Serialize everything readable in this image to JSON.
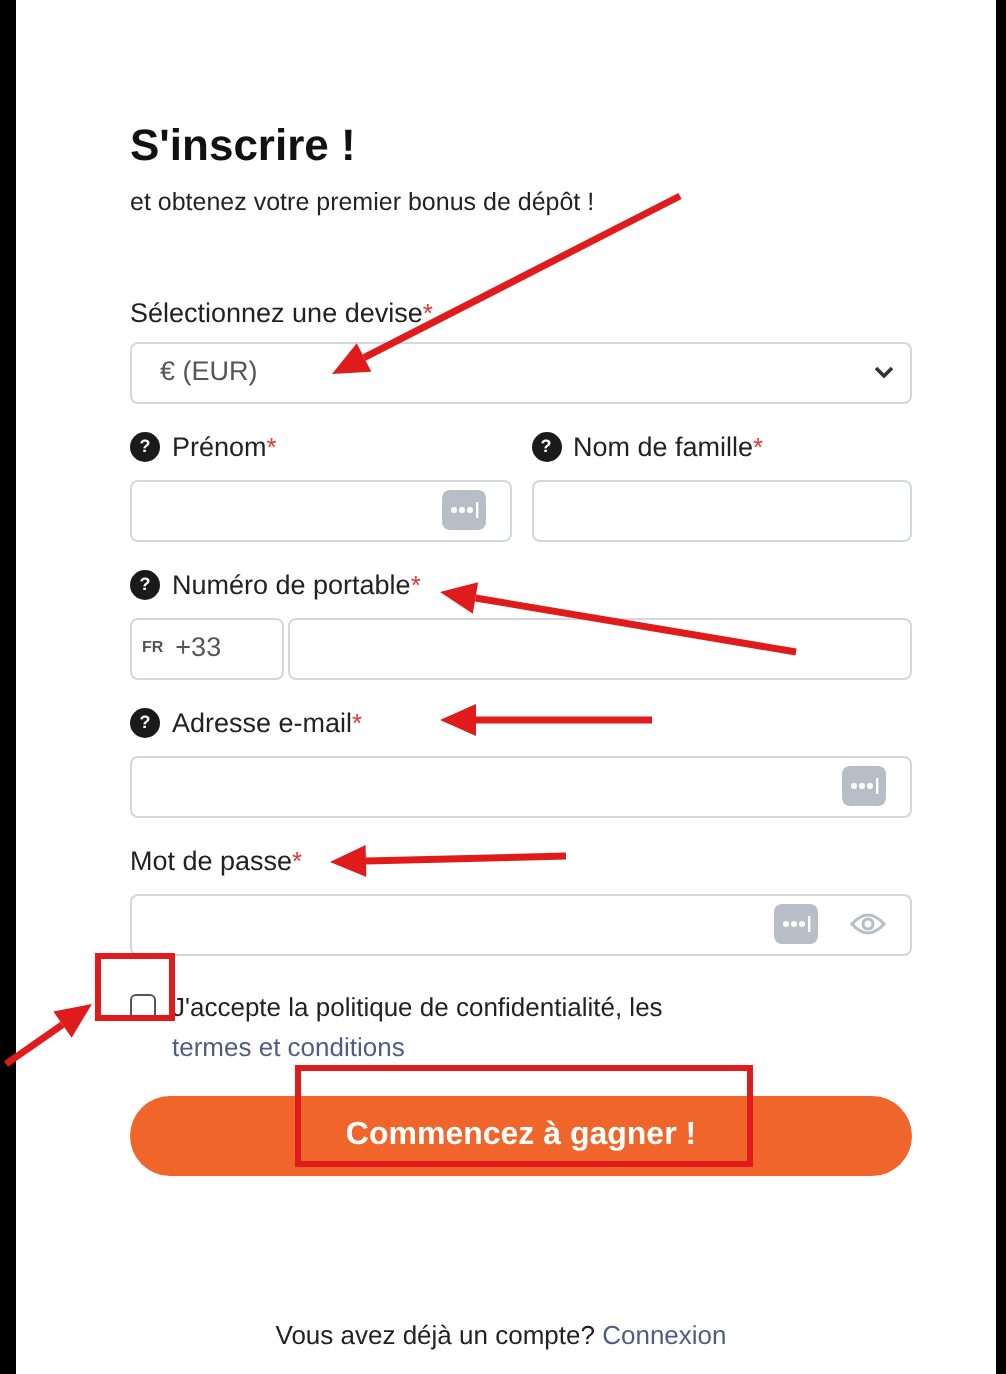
{
  "title": "S'inscrire !",
  "subtitle": "et obtenez votre premier bonus de dépôt !",
  "fields": [
    {
      "kind": "select",
      "label": "Sélectionnez une devise",
      "required_mark": "*",
      "value": "€ (EUR)"
    },
    {
      "kind": "pair",
      "items": [
        {
          "label": "Prénom",
          "required_mark": "*",
          "help": "?",
          "autofill": true
        },
        {
          "label": "Nom de famille",
          "required_mark": "*",
          "help": "?",
          "autofill": false
        }
      ]
    },
    {
      "kind": "phone",
      "label": "Numéro de portable",
      "required_mark": "*",
      "help": "?",
      "country": "FR",
      "prefix": "+33"
    },
    {
      "kind": "text",
      "label": "Adresse e-mail",
      "required_mark": "*",
      "help": "?",
      "autofill": true
    },
    {
      "kind": "password",
      "label": "Mot de passe",
      "required_mark": "*",
      "autofill": true
    }
  ],
  "consent": {
    "checked": false,
    "text": "J'accepte la politique de confidentialité, les",
    "link": "termes et conditions"
  },
  "submit": "Commencez à gagner !",
  "footer": {
    "text": "Vous avez déjà un compte?",
    "link": "Connexion"
  }
}
